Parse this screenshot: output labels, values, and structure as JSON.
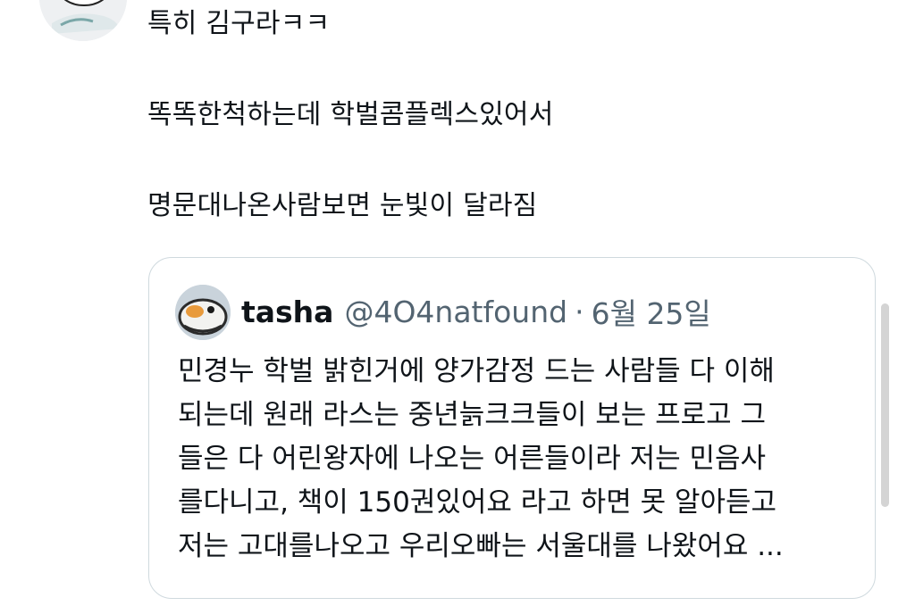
{
  "tweet": {
    "lines": [
      "특히 김구라ㅋㅋ",
      "똑똑한척하는데 학벌콤플렉스있어서",
      "명문대나온사람보면 눈빛이 달라짐"
    ]
  },
  "quote": {
    "name": "tasha",
    "handle": "@4O4natfound",
    "separator": "·",
    "date": "6월 25일",
    "lines": [
      "민경누 학벌 밝힌거에 양가감정 드는 사람들 다 이해",
      "되는데 원래 라스는 중년늙크크들이 보는 프로고 그",
      "들은 다 어린왕자에 나오는 어른들이라 저는 민음사",
      "를다니고, 책이 150권있어요 라고 하면 못 알아듣고",
      "저는 고대를나오고 우리오빠는 서울대를 나왔어요 ..."
    ]
  },
  "colors": {
    "text": "#0f1419",
    "secondary": "#536471",
    "border": "#cfd9de"
  }
}
